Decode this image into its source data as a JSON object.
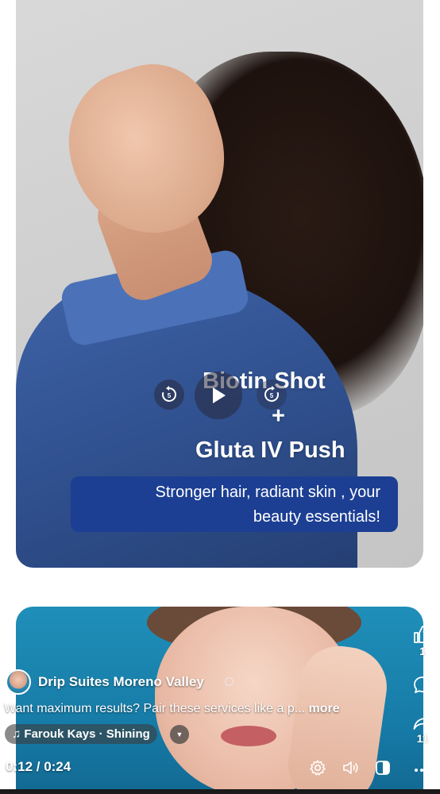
{
  "card1": {
    "headline_line1": "Biotin Shot",
    "headline_plus": "+",
    "headline_line2": "Gluta IV Push",
    "tagline_line1": "Stronger hair, radiant skin , your",
    "tagline_line2": "beauty essentials!"
  },
  "player": {
    "rewind_label": "5",
    "forward_label": "5",
    "rewind_icon": "rewind-5-icon",
    "play_icon": "play-icon",
    "forward_icon": "forward-5-icon"
  },
  "post": {
    "page_name": "Drip Suites Moreno Valley",
    "caption": "Want maximum results? Pair these services like a p...",
    "caption_more": "more",
    "music": "♫ Farouk Kays · Shining",
    "time": "0:12 / 0:24"
  },
  "rail": {
    "like_count": "1",
    "share_count": "11"
  },
  "colors": {
    "tagline_bg": "#1c3f93",
    "card2_bg": "#1f8fb9"
  }
}
